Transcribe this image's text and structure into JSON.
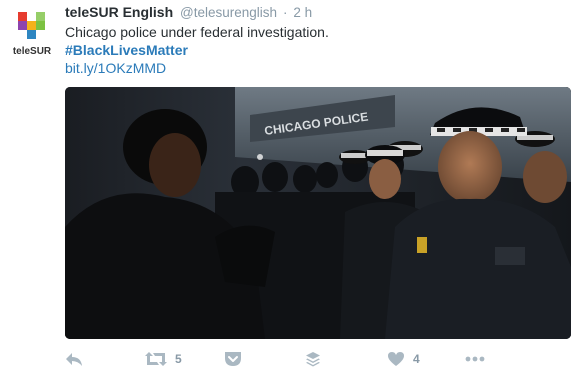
{
  "tweet": {
    "author_name": "teleSUR English",
    "handle": "@telesurenglish",
    "separator": "·",
    "time": "2 h",
    "avatar_label": "teleSUR",
    "text_line1": "Chicago police under federal investigation.",
    "hashtag": "#BlackLivesMatter",
    "link": "bit.ly/1OKzMMD",
    "photo_sign_text": "CHICAGO POLICE",
    "colors": {
      "link": "#2b7bb9",
      "muted": "#8899a6",
      "icon": "#aab8c2",
      "logo_red": "#e63c2f",
      "logo_green": "#7cc242",
      "logo_blue": "#2e86c1",
      "logo_purple": "#8e44ad",
      "logo_yellow": "#f5b21b"
    }
  },
  "actions": {
    "reply_icon": "reply-icon",
    "retweet_icon": "retweet-icon",
    "retweet_count": "5",
    "pocket_icon": "pocket-icon",
    "buffer_icon": "buffer-icon",
    "like_icon": "heart-icon",
    "like_count": "4",
    "more_icon": "more-icon"
  }
}
